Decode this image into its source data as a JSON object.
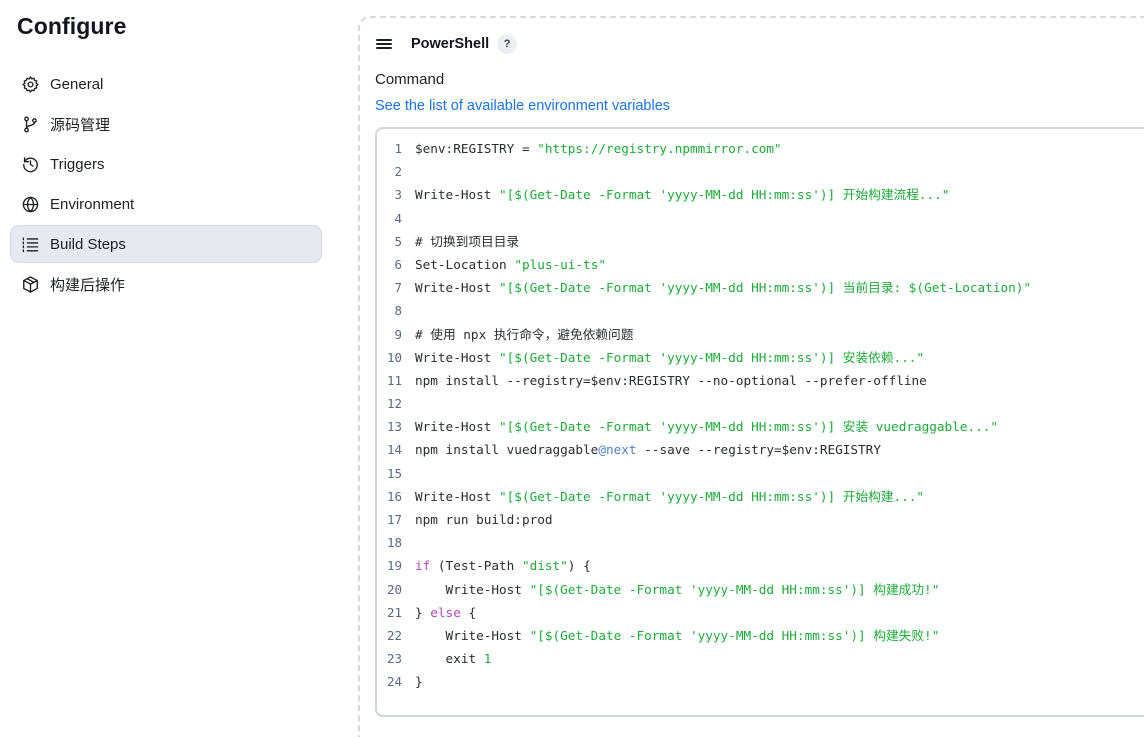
{
  "sidebar": {
    "title": "Configure",
    "items": [
      {
        "label": "General",
        "icon": "gear-icon",
        "active": false
      },
      {
        "label": "源码管理",
        "icon": "branch-icon",
        "active": false
      },
      {
        "label": "Triggers",
        "icon": "clock-icon",
        "active": false
      },
      {
        "label": "Environment",
        "icon": "globe-icon",
        "active": false
      },
      {
        "label": "Build Steps",
        "icon": "list-icon",
        "active": true
      },
      {
        "label": "构建后操作",
        "icon": "package-icon",
        "active": false
      }
    ]
  },
  "step": {
    "title": "PowerShell",
    "help": "?",
    "command_label": "Command",
    "env_prefix": "See",
    "env_link": "the list of available environment variables"
  },
  "colors": {
    "string": "#1faa3a",
    "keyword": "#b347bd",
    "link": "#1a73e8",
    "active_bg": "#e7e9f1"
  },
  "code_lines": [
    [
      [
        "p",
        "$env:REGISTRY = "
      ],
      [
        "s",
        "\"https://registry.npmmirror.com\""
      ]
    ],
    [],
    [
      [
        "p",
        "Write-Host "
      ],
      [
        "s",
        "\"[$(Get-Date -Format 'yyyy-MM-dd HH:mm:ss')] 开始构建流程...\""
      ]
    ],
    [],
    [
      [
        "c",
        "# 切换到项目目录"
      ]
    ],
    [
      [
        "p",
        "Set-Location "
      ],
      [
        "s",
        "\"plus-ui-ts\""
      ]
    ],
    [
      [
        "p",
        "Write-Host "
      ],
      [
        "s",
        "\"[$(Get-Date -Format 'yyyy-MM-dd HH:mm:ss')] 当前目录: $(Get-Location)\""
      ]
    ],
    [],
    [
      [
        "c",
        "# 使用 npx 执行命令，避免依赖问题"
      ]
    ],
    [
      [
        "p",
        "Write-Host "
      ],
      [
        "s",
        "\"[$(Get-Date -Format 'yyyy-MM-dd HH:mm:ss')] 安装依赖...\""
      ]
    ],
    [
      [
        "p",
        "npm install --registry=$env:REGISTRY --no-optional --prefer-offline"
      ]
    ],
    [],
    [
      [
        "p",
        "Write-Host "
      ],
      [
        "s",
        "\"[$(Get-Date -Format 'yyyy-MM-dd HH:mm:ss')] 安装 vuedraggable...\""
      ]
    ],
    [
      [
        "p",
        "npm install vuedraggable"
      ],
      [
        "a",
        "@next"
      ],
      [
        "p",
        " --save --registry=$env:REGISTRY"
      ]
    ],
    [],
    [
      [
        "p",
        "Write-Host "
      ],
      [
        "s",
        "\"[$(Get-Date -Format 'yyyy-MM-dd HH:mm:ss')] 开始构建...\""
      ]
    ],
    [
      [
        "p",
        "npm run build:prod"
      ]
    ],
    [],
    [
      [
        "k",
        "if"
      ],
      [
        "p",
        " (Test-Path "
      ],
      [
        "s",
        "\"dist\""
      ],
      [
        "p",
        ") {"
      ]
    ],
    [
      [
        "p",
        "    Write-Host "
      ],
      [
        "s",
        "\"[$(Get-Date -Format 'yyyy-MM-dd HH:mm:ss')] 构建成功!\""
      ]
    ],
    [
      [
        "p",
        "} "
      ],
      [
        "k",
        "else"
      ],
      [
        "p",
        " {"
      ]
    ],
    [
      [
        "p",
        "    Write-Host "
      ],
      [
        "s",
        "\"[$(Get-Date -Format 'yyyy-MM-dd HH:mm:ss')] 构建失败!\""
      ]
    ],
    [
      [
        "p",
        "    exit "
      ],
      [
        "n",
        "1"
      ]
    ],
    [
      [
        "p",
        "}"
      ]
    ]
  ]
}
